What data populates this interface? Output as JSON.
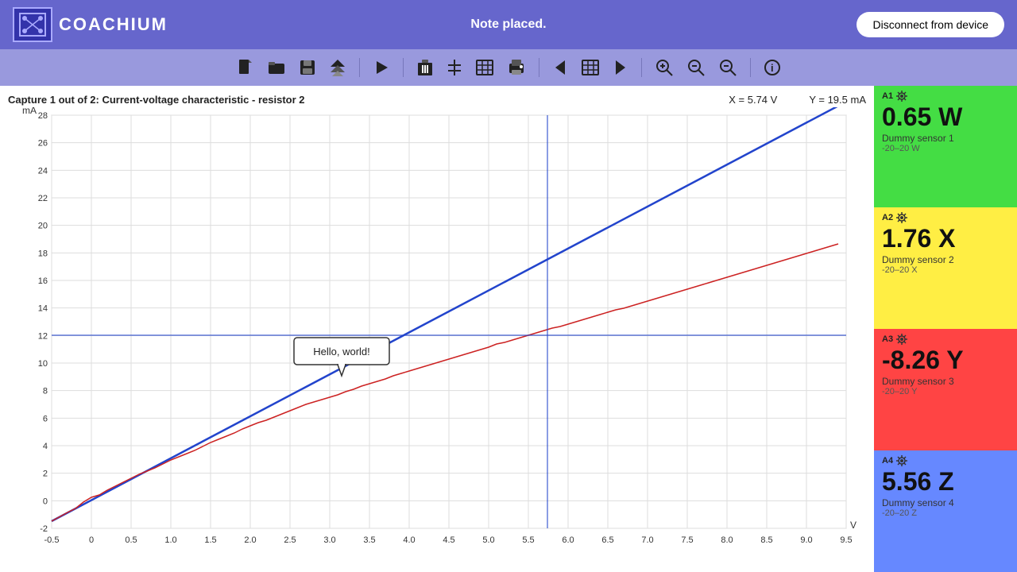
{
  "header": {
    "logo_text": "COACHIUM",
    "status_text": "Note placed.",
    "disconnect_label": "Disconnect from device"
  },
  "toolbar": {
    "icons": [
      {
        "name": "new-file-icon",
        "glyph": "📄"
      },
      {
        "name": "open-file-icon",
        "glyph": "📂"
      },
      {
        "name": "save-icon",
        "glyph": "💾"
      },
      {
        "name": "drive-icon",
        "glyph": "▲"
      },
      {
        "name": "play-icon",
        "glyph": "▶"
      },
      {
        "name": "delete-icon",
        "glyph": "🗑"
      },
      {
        "name": "cut-icon",
        "glyph": "✂"
      },
      {
        "name": "table-icon",
        "glyph": "⊞"
      },
      {
        "name": "export-icon",
        "glyph": "🖨"
      },
      {
        "name": "prev-icon",
        "glyph": "❮"
      },
      {
        "name": "grid-icon",
        "glyph": "⊞"
      },
      {
        "name": "next-icon",
        "glyph": "❯"
      },
      {
        "name": "zoom-in-icon",
        "glyph": "🔍"
      },
      {
        "name": "zoom-fit-icon",
        "glyph": "🔎"
      },
      {
        "name": "zoom-out-icon",
        "glyph": "🔍"
      },
      {
        "name": "info-icon",
        "glyph": "ℹ"
      }
    ]
  },
  "chart": {
    "title": "Capture 1 out of 2: Current-voltage characteristic - resistor 2",
    "x_label": "V",
    "y_label": "mA",
    "x_coord": "X = 5.74 V",
    "y_coord": "Y = 19.5 mA",
    "note_text": "Hello, world!"
  },
  "sensors": [
    {
      "id": "A1",
      "value": "0.65 W",
      "name": "Dummy sensor 1",
      "range": "-20–20 W",
      "color": "green"
    },
    {
      "id": "A2",
      "value": "1.76 X",
      "name": "Dummy sensor 2",
      "range": "-20–20 X",
      "color": "yellow"
    },
    {
      "id": "A3",
      "value": "-8.26 Y",
      "name": "Dummy sensor 3",
      "range": "-20–20 Y",
      "color": "red"
    },
    {
      "id": "A4",
      "value": "5.56 Z",
      "name": "Dummy sensor 4",
      "range": "-20–20 Z",
      "color": "blue"
    }
  ]
}
